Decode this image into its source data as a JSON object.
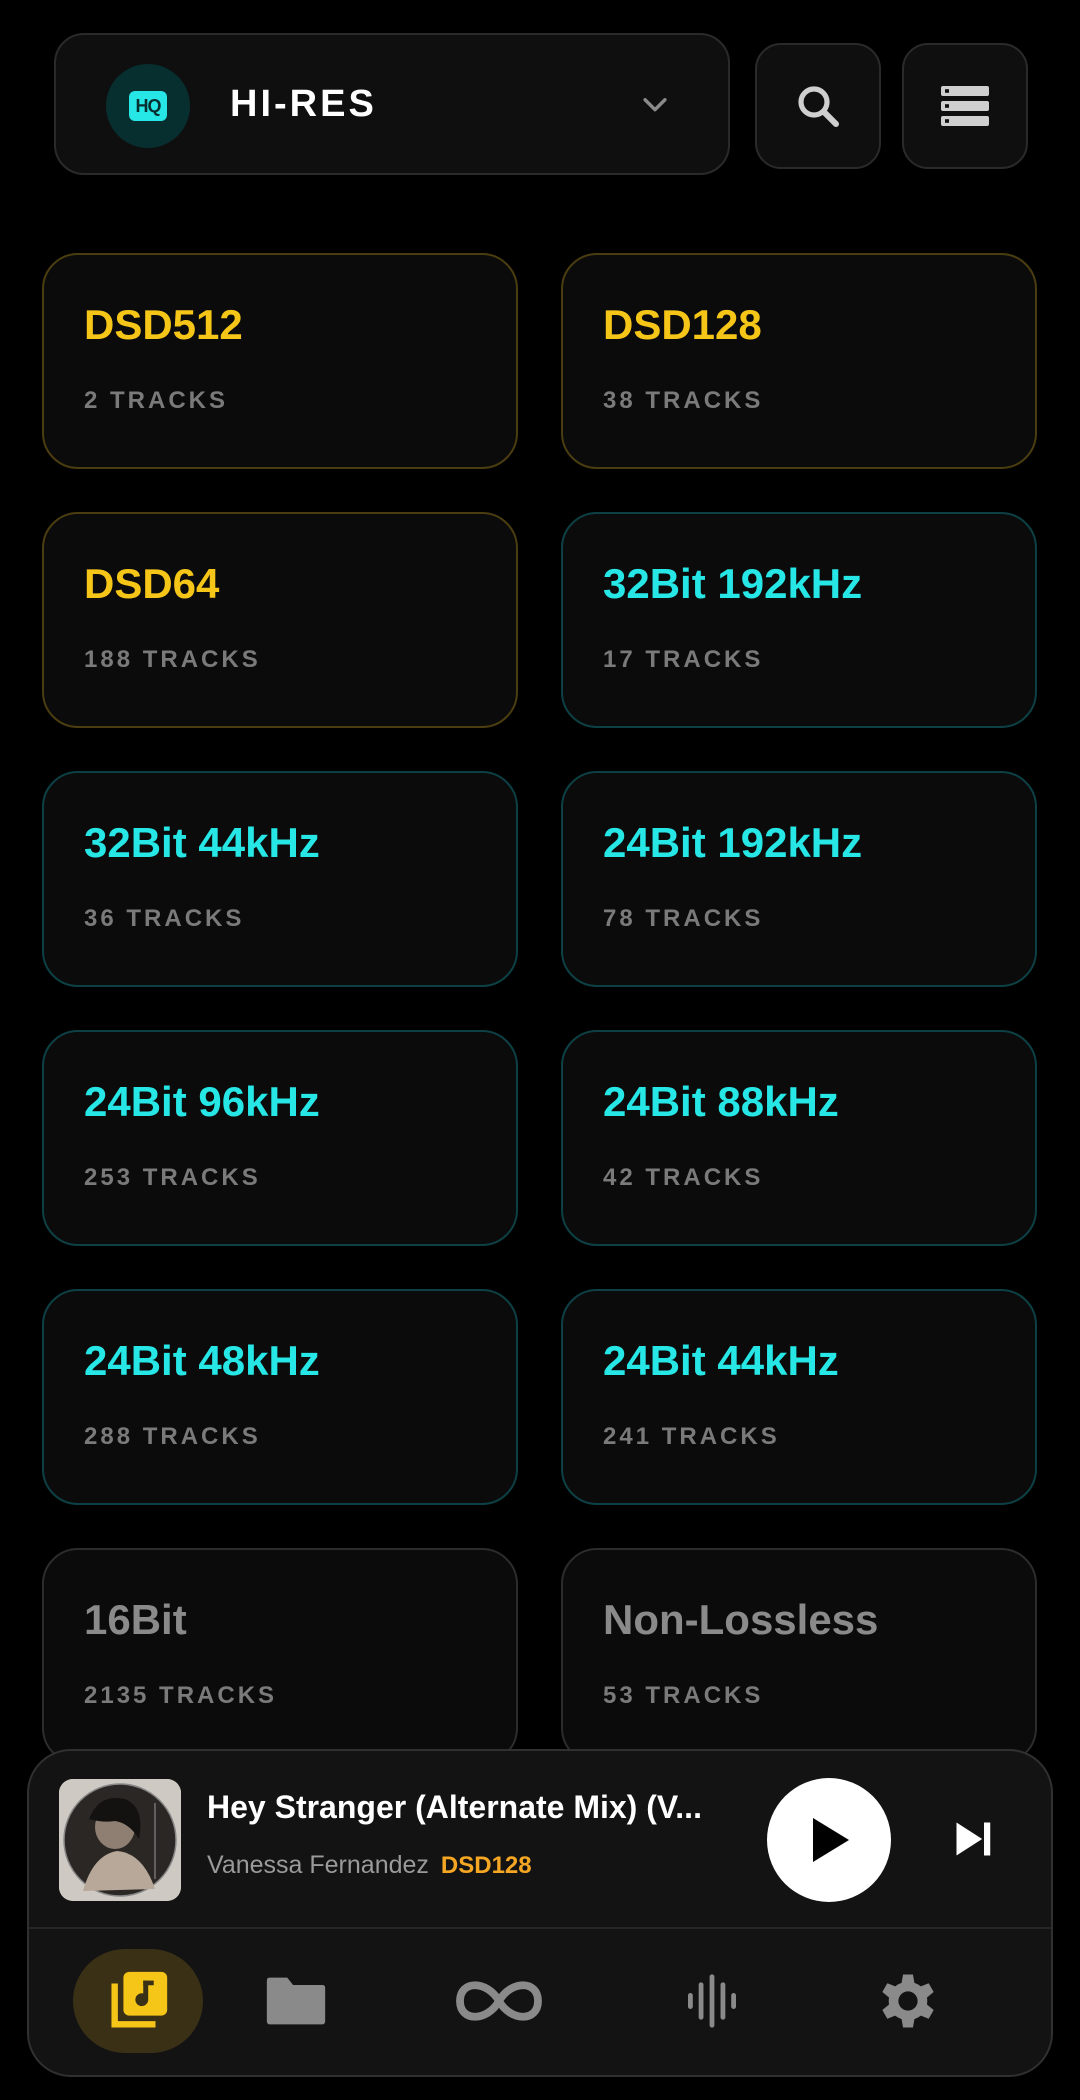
{
  "header": {
    "selector_title": "HI-RES",
    "badge_text": "HQ",
    "search_icon": "search-icon",
    "view_icon": "list-view-icon"
  },
  "categories": [
    {
      "title": "DSD512",
      "subtitle": "2 TRACKS",
      "style": "gold"
    },
    {
      "title": "DSD128",
      "subtitle": "38 TRACKS",
      "style": "gold"
    },
    {
      "title": "DSD64",
      "subtitle": "188 TRACKS",
      "style": "gold"
    },
    {
      "title": "32Bit 192kHz",
      "subtitle": "17 TRACKS",
      "style": "cyan"
    },
    {
      "title": "32Bit 44kHz",
      "subtitle": "36 TRACKS",
      "style": "cyan"
    },
    {
      "title": "24Bit 192kHz",
      "subtitle": "78 TRACKS",
      "style": "cyan"
    },
    {
      "title": "24Bit 96kHz",
      "subtitle": "253 TRACKS",
      "style": "cyan"
    },
    {
      "title": "24Bit 88kHz",
      "subtitle": "42 TRACKS",
      "style": "cyan"
    },
    {
      "title": "24Bit 48kHz",
      "subtitle": "288 TRACKS",
      "style": "cyan"
    },
    {
      "title": "24Bit 44kHz",
      "subtitle": "241 TRACKS",
      "style": "cyan"
    },
    {
      "title": "16Bit",
      "subtitle": "2135 TRACKS",
      "style": "gray"
    },
    {
      "title": "Non-Lossless",
      "subtitle": "53 TRACKS",
      "style": "gray"
    }
  ],
  "now_playing": {
    "title": "Hey Stranger (Alternate Mix) (V...",
    "artist": "Vanessa Fernandez",
    "format": "DSD128"
  },
  "nav": {
    "items": [
      "library-icon",
      "folder-icon",
      "infinity-icon",
      "waveform-icon",
      "settings-icon"
    ],
    "active_index": 0
  },
  "colors": {
    "gold": "#f5c518",
    "cyan": "#26e6e6",
    "format_badge": "#f5a623",
    "background": "#000000"
  }
}
